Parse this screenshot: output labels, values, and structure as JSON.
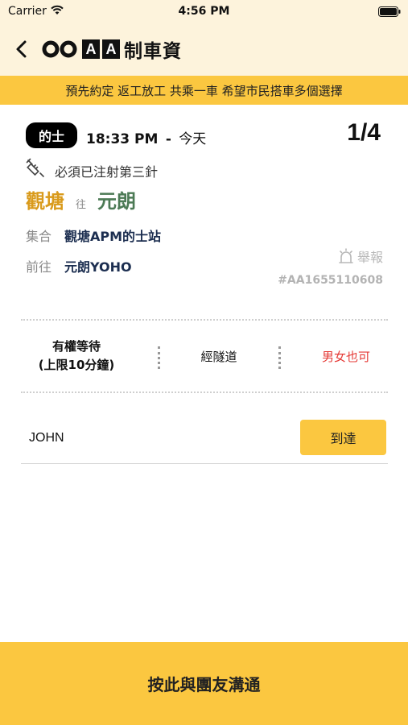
{
  "status_bar": {
    "carrier": "Carrier",
    "time": "4:56 PM"
  },
  "nav": {
    "logo_boxes": [
      "A",
      "A"
    ],
    "logo_text": "制車資",
    "back_icon": "chevron-left-icon"
  },
  "banner": {
    "text": "預先約定 返工放工 共乘一車 希望市民搭車多個選擇"
  },
  "trip": {
    "vehicle_badge": "的士",
    "time": "18:33 PM",
    "time_separator": "-",
    "day": "今天",
    "count": "1/4",
    "vaccine_requirement": "必須已注射第三針",
    "from": "觀塘",
    "to_word": "往",
    "destination": "元朗",
    "meet_label": "集合",
    "meet_value": "觀塘APM的士站",
    "dest_label": "前往",
    "dest_value": "元朗YOHO",
    "report_label": "舉報",
    "ref_code": "#AA1655110608"
  },
  "options": {
    "wait_line1": "有權等待",
    "wait_line2": "(上限10分鐘)",
    "route": "經隧道",
    "gender": "男女也可"
  },
  "participant": {
    "name": "JOHN",
    "arrive_label": "到達"
  },
  "footer": {
    "chat_label": "按此與團友溝通"
  },
  "colors": {
    "accent_yellow": "#fbc740",
    "header_bg": "#fdf3dc",
    "from_color": "#d99a1b",
    "dest_color": "#4c7a55",
    "gender_color": "#e53935",
    "value_navy": "#1c2e50"
  }
}
